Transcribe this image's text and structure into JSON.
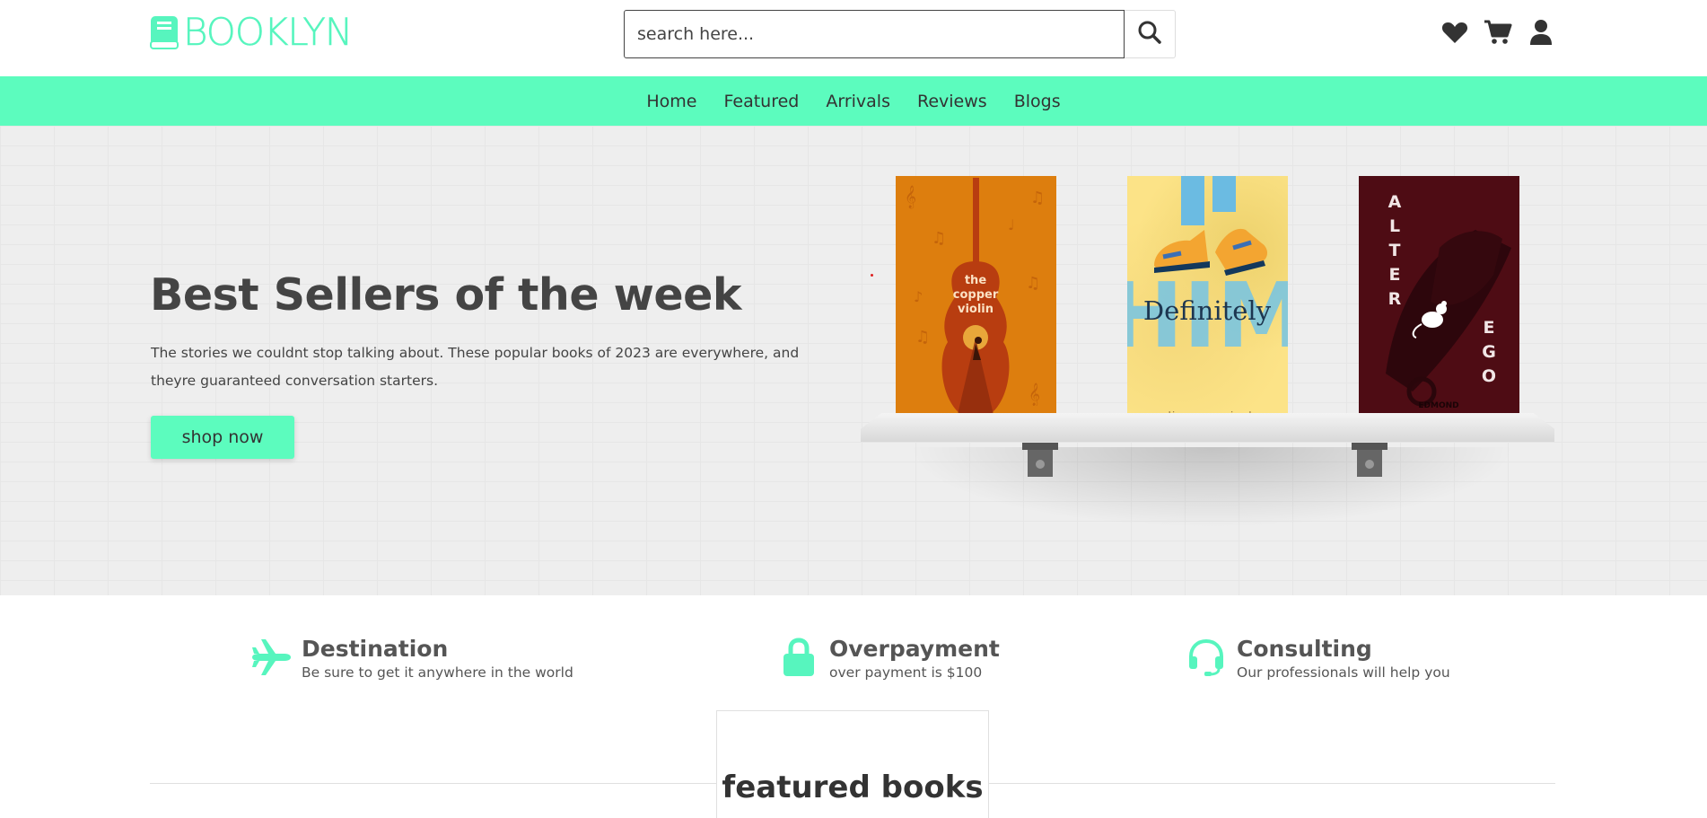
{
  "brand": {
    "name": "BOOKLYN",
    "accent": "#57f5be"
  },
  "search": {
    "placeholder": "search here..."
  },
  "header_icons": [
    "heart-icon",
    "cart-icon",
    "user-icon"
  ],
  "nav": {
    "items": [
      "Home",
      "Featured",
      "Arrivals",
      "Reviews",
      "Blogs"
    ],
    "bg": "#5cfcbe"
  },
  "hero": {
    "title": "Best Sellers of the week",
    "description": "The stories we couldnt stop talking about. These popular books of 2023 are everywhere, and theyre guaranteed conversation starters.",
    "button": "shop now",
    "books": [
      {
        "title": "the copper violin",
        "color": "#dd7e0e"
      },
      {
        "title": "Definitely",
        "overlay": "HIM",
        "author": "celine ann nicole",
        "color": "#fce387"
      },
      {
        "title": "ALTER EGO",
        "author": "EDMOND",
        "color": "#4e0c14"
      }
    ]
  },
  "features": [
    {
      "icon": "plane-icon",
      "title": "Destination",
      "subtitle": "Be sure to get it anywhere in the world"
    },
    {
      "icon": "lock-icon",
      "title": "Overpayment",
      "subtitle": "over payment is $100"
    },
    {
      "icon": "headset-icon",
      "title": "Consulting",
      "subtitle": "Our professionals will help you"
    }
  ],
  "featured": {
    "title": "featured books"
  }
}
